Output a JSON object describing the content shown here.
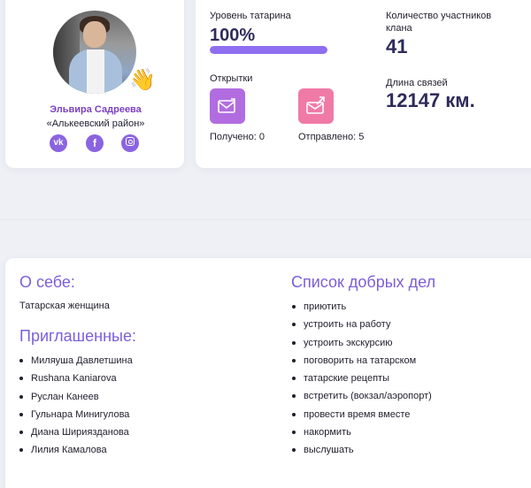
{
  "profile": {
    "name": "Эльвира Садреева",
    "district": "«Алькеевский район»",
    "wave_emoji": "👋",
    "social": [
      {
        "icon": "vk-icon",
        "glyph": "vk"
      },
      {
        "icon": "facebook-icon",
        "glyph": "f"
      },
      {
        "icon": "instagram-icon",
        "glyph": ""
      }
    ]
  },
  "stats": {
    "level_label": "Уровень татарина",
    "level_value": "100%",
    "level_progress": 1.0,
    "clan_label": "Количество участников клана",
    "clan_value": "41",
    "link_label": "Длина связей",
    "link_value": "12147 км.",
    "cards_label": "Открытки",
    "received": "Получено: 0",
    "sent": "Отправлено: 5"
  },
  "about": {
    "title": "О себе:",
    "text": "Татарская женщина"
  },
  "invited": {
    "title": "Приглашенные:",
    "items": [
      "Миляуша Давлетшина",
      "Rushana Kaniarova",
      "Руслан Канеев",
      "Гульнара Минигулова",
      "Диана Ширияздaнова",
      "Лилия Камалова"
    ]
  },
  "deeds": {
    "title": "Список добрых дел",
    "items": [
      "приютить",
      "устроить на работу",
      "устроить экскурсию",
      "поговорить на татарском",
      "татарские рецепты",
      "встретить (вокзал/аэропорт)",
      "провести время вместе",
      "накормить",
      "выслушать"
    ]
  },
  "colors": {
    "accent": "#7b5fd8",
    "progress": "#8f6ef0",
    "received_icon": "#b16de0",
    "sent_icon": "#f07aa6",
    "name": "#7a3fbf"
  }
}
